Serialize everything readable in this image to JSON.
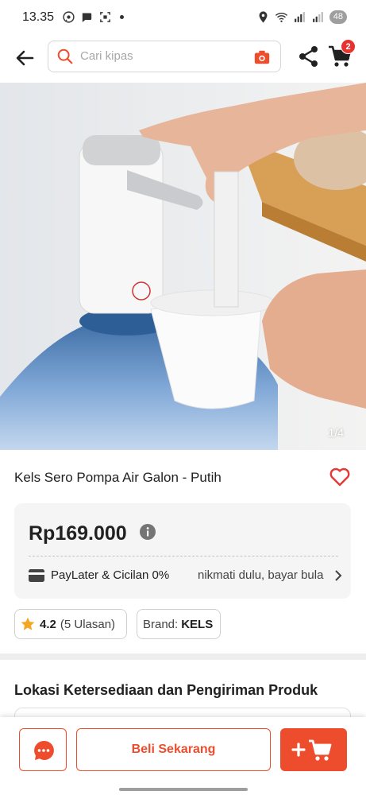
{
  "status_bar": {
    "time": "13.35",
    "battery": "48"
  },
  "header": {
    "search_placeholder": "Cari kipas",
    "cart_count": "2"
  },
  "product": {
    "image_counter": "1/4",
    "title": "Kels Sero Pompa Air Galon - Putih",
    "price": "Rp169.000",
    "paylater_label": "PayLater & Cicilan 0%",
    "paylater_desc": "nikmati dulu, bayar bula",
    "rating": "4.2",
    "rating_count": "(5 Ulasan)",
    "brand_label": "Brand:",
    "brand_value": "KELS"
  },
  "section": {
    "location_title": "Lokasi Ketersediaan dan Pengiriman Produk"
  },
  "bottom_bar": {
    "buy_label": "Beli Sekarang"
  },
  "colors": {
    "accent": "#ee4d2d",
    "badge": "#e8322f",
    "star": "#f5a623"
  }
}
